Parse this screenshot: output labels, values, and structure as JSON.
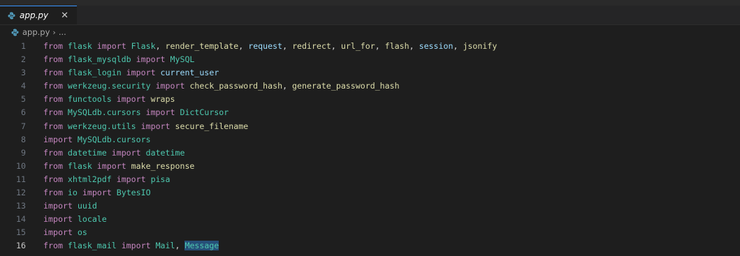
{
  "tab": {
    "label": "app.py",
    "close_glyph": "✕",
    "icon": "python-file-icon"
  },
  "breadcrumb": {
    "file": "app.py",
    "separator": "›",
    "more": "..."
  },
  "colors": {
    "keyword": "#c586c0",
    "module": "#4ec9b0",
    "function": "#dcdcaa",
    "variable": "#9cdcfe",
    "text": "#d4d4d4",
    "line_number": "#6e7681",
    "active_line_number": "#c6c6c6",
    "background": "#1e1e1e"
  },
  "active_line": 16,
  "code_lines": [
    {
      "n": "1",
      "tokens": [
        [
          "kw",
          "from"
        ],
        [
          "t",
          " "
        ],
        [
          "mod",
          "flask"
        ],
        [
          "t",
          " "
        ],
        [
          "kw",
          "import"
        ],
        [
          "t",
          " "
        ],
        [
          "mod",
          "Flask"
        ],
        [
          "t",
          ", "
        ],
        [
          "fn",
          "render_template"
        ],
        [
          "t",
          ", "
        ],
        [
          "var",
          "request"
        ],
        [
          "t",
          ", "
        ],
        [
          "fn",
          "redirect"
        ],
        [
          "t",
          ", "
        ],
        [
          "fn",
          "url_for"
        ],
        [
          "t",
          ", "
        ],
        [
          "fn",
          "flash"
        ],
        [
          "t",
          ", "
        ],
        [
          "var",
          "session"
        ],
        [
          "t",
          ", "
        ],
        [
          "fn",
          "jsonify"
        ]
      ]
    },
    {
      "n": "2",
      "tokens": [
        [
          "kw",
          "from"
        ],
        [
          "t",
          " "
        ],
        [
          "mod",
          "flask_mysqldb"
        ],
        [
          "t",
          " "
        ],
        [
          "kw",
          "import"
        ],
        [
          "t",
          " "
        ],
        [
          "mod",
          "MySQL"
        ]
      ]
    },
    {
      "n": "3",
      "tokens": [
        [
          "kw",
          "from"
        ],
        [
          "t",
          " "
        ],
        [
          "mod",
          "flask_login"
        ],
        [
          "t",
          " "
        ],
        [
          "kw",
          "import"
        ],
        [
          "t",
          " "
        ],
        [
          "var",
          "current_user"
        ]
      ]
    },
    {
      "n": "4",
      "tokens": [
        [
          "kw",
          "from"
        ],
        [
          "t",
          " "
        ],
        [
          "mod",
          "werkzeug.security"
        ],
        [
          "t",
          " "
        ],
        [
          "kw",
          "import"
        ],
        [
          "t",
          " "
        ],
        [
          "fn",
          "check_password_hash"
        ],
        [
          "t",
          ", "
        ],
        [
          "fn",
          "generate_password_hash"
        ]
      ]
    },
    {
      "n": "5",
      "tokens": [
        [
          "kw",
          "from"
        ],
        [
          "t",
          " "
        ],
        [
          "mod",
          "functools"
        ],
        [
          "t",
          " "
        ],
        [
          "kw",
          "import"
        ],
        [
          "t",
          " "
        ],
        [
          "fn",
          "wraps"
        ]
      ]
    },
    {
      "n": "6",
      "tokens": [
        [
          "kw",
          "from"
        ],
        [
          "t",
          " "
        ],
        [
          "mod",
          "MySQLdb.cursors"
        ],
        [
          "t",
          " "
        ],
        [
          "kw",
          "import"
        ],
        [
          "t",
          " "
        ],
        [
          "mod",
          "DictCursor"
        ]
      ]
    },
    {
      "n": "7",
      "tokens": [
        [
          "kw",
          "from"
        ],
        [
          "t",
          " "
        ],
        [
          "mod",
          "werkzeug.utils"
        ],
        [
          "t",
          " "
        ],
        [
          "kw",
          "import"
        ],
        [
          "t",
          " "
        ],
        [
          "fn",
          "secure_filename"
        ]
      ]
    },
    {
      "n": "8",
      "tokens": [
        [
          "kw",
          "import"
        ],
        [
          "t",
          " "
        ],
        [
          "mod",
          "MySQLdb.cursors"
        ]
      ]
    },
    {
      "n": "9",
      "tokens": [
        [
          "kw",
          "from"
        ],
        [
          "t",
          " "
        ],
        [
          "mod",
          "datetime"
        ],
        [
          "t",
          " "
        ],
        [
          "kw",
          "import"
        ],
        [
          "t",
          " "
        ],
        [
          "mod",
          "datetime"
        ]
      ]
    },
    {
      "n": "10",
      "tokens": [
        [
          "kw",
          "from"
        ],
        [
          "t",
          " "
        ],
        [
          "mod",
          "flask"
        ],
        [
          "t",
          " "
        ],
        [
          "kw",
          "import"
        ],
        [
          "t",
          " "
        ],
        [
          "fn",
          "make_response"
        ]
      ]
    },
    {
      "n": "11",
      "tokens": [
        [
          "kw",
          "from"
        ],
        [
          "t",
          " "
        ],
        [
          "mod",
          "xhtml2pdf"
        ],
        [
          "t",
          " "
        ],
        [
          "kw",
          "import"
        ],
        [
          "t",
          " "
        ],
        [
          "mod",
          "pisa"
        ]
      ]
    },
    {
      "n": "12",
      "tokens": [
        [
          "kw",
          "from"
        ],
        [
          "t",
          " "
        ],
        [
          "mod",
          "io"
        ],
        [
          "t",
          " "
        ],
        [
          "kw",
          "import"
        ],
        [
          "t",
          " "
        ],
        [
          "mod",
          "BytesIO"
        ]
      ]
    },
    {
      "n": "13",
      "tokens": [
        [
          "kw",
          "import"
        ],
        [
          "t",
          " "
        ],
        [
          "mod",
          "uuid"
        ]
      ]
    },
    {
      "n": "14",
      "tokens": [
        [
          "kw",
          "import"
        ],
        [
          "t",
          " "
        ],
        [
          "mod",
          "locale"
        ]
      ]
    },
    {
      "n": "15",
      "tokens": [
        [
          "kw",
          "import"
        ],
        [
          "t",
          " "
        ],
        [
          "mod",
          "os"
        ]
      ]
    },
    {
      "n": "16",
      "tokens": [
        [
          "kw",
          "from"
        ],
        [
          "t",
          " "
        ],
        [
          "mod",
          "flask_mail"
        ],
        [
          "t",
          " "
        ],
        [
          "kw",
          "import"
        ],
        [
          "t",
          " "
        ],
        [
          "mod",
          "Mail"
        ],
        [
          "t",
          ", "
        ],
        [
          "hl",
          "Message"
        ]
      ]
    }
  ]
}
